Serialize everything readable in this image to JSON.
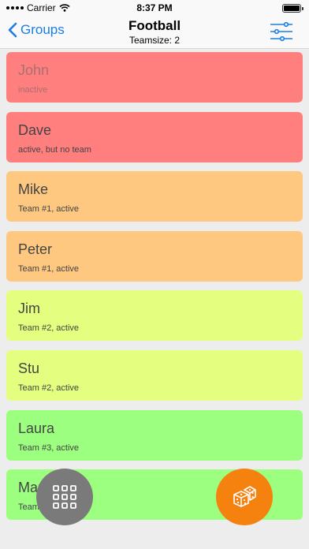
{
  "status_bar": {
    "carrier": "Carrier",
    "time": "8:37 PM"
  },
  "nav": {
    "back_label": "Groups",
    "title": "Football",
    "subtitle": "Teamsize: 2",
    "accent_color": "#1a7ee6"
  },
  "players": [
    {
      "name": "John",
      "status": "inactive",
      "color": "#ff7f7f"
    },
    {
      "name": "Dave",
      "status": "active, but no team",
      "color": "#ff7f7f"
    },
    {
      "name": "Mike",
      "status": "Team #1, active",
      "color": "#ffc880"
    },
    {
      "name": "Peter",
      "status": "Team #1, active",
      "color": "#ffc880"
    },
    {
      "name": "Jim",
      "status": "Team #2, active",
      "color": "#e4ff80"
    },
    {
      "name": "Stu",
      "status": "Team #2, active",
      "color": "#e4ff80"
    },
    {
      "name": "Laura",
      "status": "Team #3, active",
      "color": "#9dff80"
    },
    {
      "name": "Mary",
      "status": "Team #3, active",
      "color": "#9dff80"
    }
  ],
  "fabs": {
    "grid_icon": "grid-icon",
    "grid_color": "#7a7a7a",
    "dice_icon": "dice-icon",
    "dice_color": "#f5820f"
  }
}
